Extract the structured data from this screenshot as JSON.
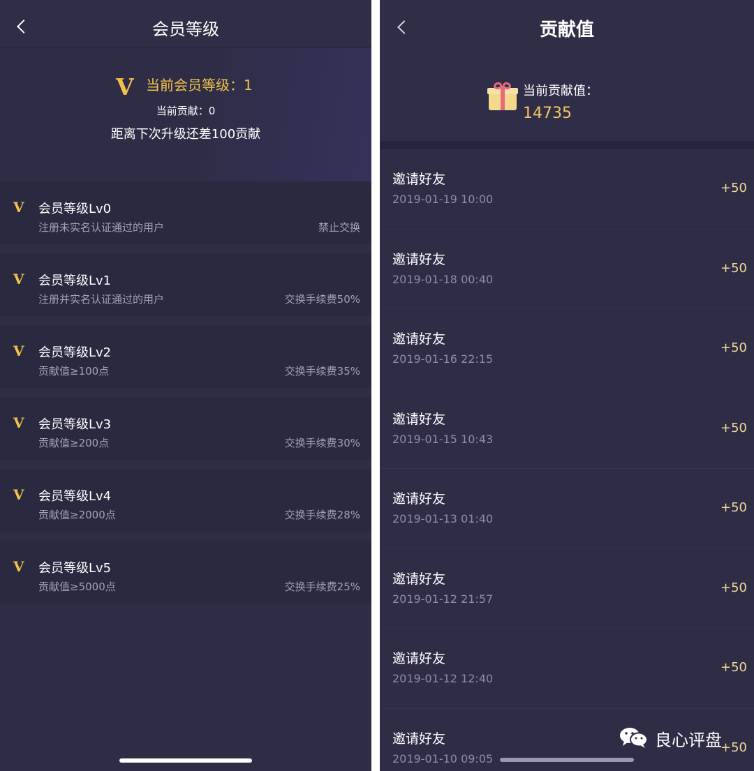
{
  "left": {
    "nav": {
      "title": "会员等级"
    },
    "header": {
      "current_level_label": "当前会员等级：1",
      "current_contribution": "当前贡献：0",
      "next_level_text": "距离下次升级还差100贡献"
    },
    "levels": [
      {
        "name": "会员等级Lv0",
        "desc": "注册未实名认证通过的用户",
        "fee": "禁止交换"
      },
      {
        "name": "会员等级Lv1",
        "desc": "注册并实名认证通过的用户",
        "fee": "交换手续费50%"
      },
      {
        "name": "会员等级Lv2",
        "desc": "贡献值≥100点",
        "fee": "交换手续费35%"
      },
      {
        "name": "会员等级Lv3",
        "desc": "贡献值≥200点",
        "fee": "交换手续费30%"
      },
      {
        "name": "会员等级Lv4",
        "desc": "贡献值≥2000点",
        "fee": "交换手续费28%"
      },
      {
        "name": "会员等级Lv5",
        "desc": "贡献值≥5000点",
        "fee": "交换手续费25%"
      }
    ]
  },
  "right": {
    "nav": {
      "title": "贡献值"
    },
    "header": {
      "label": "当前贡献值：",
      "value": "14735"
    },
    "records": [
      {
        "title": "邀请好友",
        "time": "2019-01-19 10:00",
        "points": "+50"
      },
      {
        "title": "邀请好友",
        "time": "2019-01-18 00:40",
        "points": "+50"
      },
      {
        "title": "邀请好友",
        "time": "2019-01-16 22:15",
        "points": "+50"
      },
      {
        "title": "邀请好友",
        "time": "2019-01-15 10:43",
        "points": "+50"
      },
      {
        "title": "邀请好友",
        "time": "2019-01-13 01:40",
        "points": "+50"
      },
      {
        "title": "邀请好友",
        "time": "2019-01-12 21:57",
        "points": "+50"
      },
      {
        "title": "邀请好友",
        "time": "2019-01-12 12:40",
        "points": "+50"
      },
      {
        "title": "邀请好友",
        "time": "2019-01-10 09:05",
        "points": "+50"
      }
    ]
  },
  "watermark": {
    "text": "良心评盘"
  },
  "icons": {
    "level_badge": "v-icon",
    "back": "chevron-left-icon",
    "gift": "gift-icon",
    "wechat": "wechat-icon"
  },
  "colors": {
    "background": "#2f2d45",
    "accent_gold": "#f0c24a",
    "muted_text": "#a3a2b3"
  }
}
